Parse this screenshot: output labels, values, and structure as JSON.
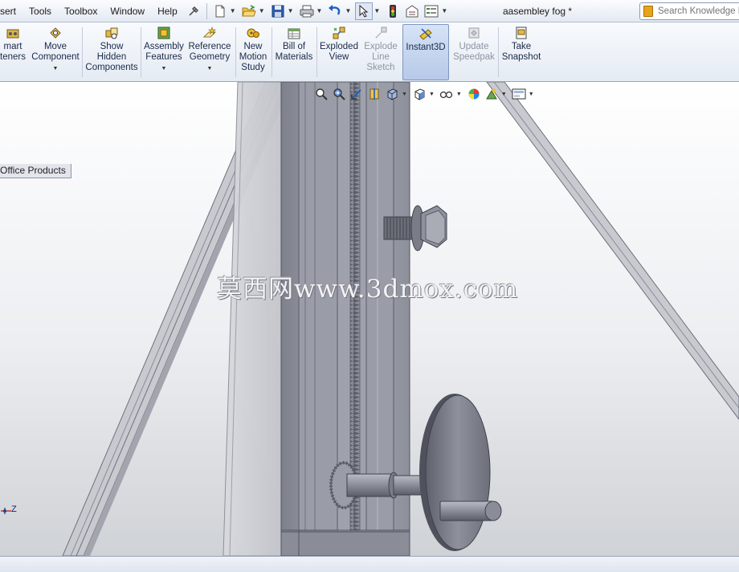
{
  "menu": {
    "items": [
      "sert",
      "Tools",
      "Toolbox",
      "Window",
      "Help"
    ]
  },
  "document": {
    "title": "aasembley fog *"
  },
  "search": {
    "placeholder": "Search Knowledge Base"
  },
  "commands": [
    {
      "label": "mart\nteners",
      "has_dropdown": false,
      "state": "normal",
      "icon": "smart-fasteners-icon"
    },
    {
      "label": "Move\nComponent",
      "has_dropdown": true,
      "state": "normal",
      "icon": "move-component-icon"
    },
    {
      "label": "Show\nHidden\nComponents",
      "has_dropdown": false,
      "state": "normal",
      "icon": "show-hidden-icon"
    },
    {
      "label": "Assembly\nFeatures",
      "has_dropdown": true,
      "state": "normal",
      "icon": "assembly-features-icon"
    },
    {
      "label": "Reference\nGeometry",
      "has_dropdown": true,
      "state": "normal",
      "icon": "reference-geometry-icon"
    },
    {
      "label": "New\nMotion\nStudy",
      "has_dropdown": false,
      "state": "normal",
      "icon": "motion-study-icon"
    },
    {
      "label": "Bill of\nMaterials",
      "has_dropdown": false,
      "state": "normal",
      "icon": "bill-of-materials-icon"
    },
    {
      "label": "Exploded\nView",
      "has_dropdown": false,
      "state": "normal",
      "icon": "exploded-view-icon"
    },
    {
      "label": "Explode\nLine\nSketch",
      "has_dropdown": false,
      "state": "disabled",
      "icon": "explode-line-icon"
    },
    {
      "label": "Instant3D",
      "has_dropdown": false,
      "state": "active",
      "icon": "instant3d-icon"
    },
    {
      "label": "Update\nSpeedpak",
      "has_dropdown": false,
      "state": "disabled",
      "icon": "speedpak-icon"
    },
    {
      "label": "Take\nSnapshot",
      "has_dropdown": false,
      "state": "normal",
      "icon": "snapshot-icon"
    }
  ],
  "tab": {
    "label": "Office Products"
  },
  "viewport": {
    "watermark": "莫西网www.3dmox.com",
    "triad_label": "Z"
  },
  "colors": {
    "accent_blue": "#1f5fbf",
    "background_top": "#ffffff",
    "background_bottom": "#cfd2d6",
    "metal_dark": "#5b5e6a",
    "metal_mid": "#8a8d98",
    "metal_light": "#b9bcc6"
  }
}
